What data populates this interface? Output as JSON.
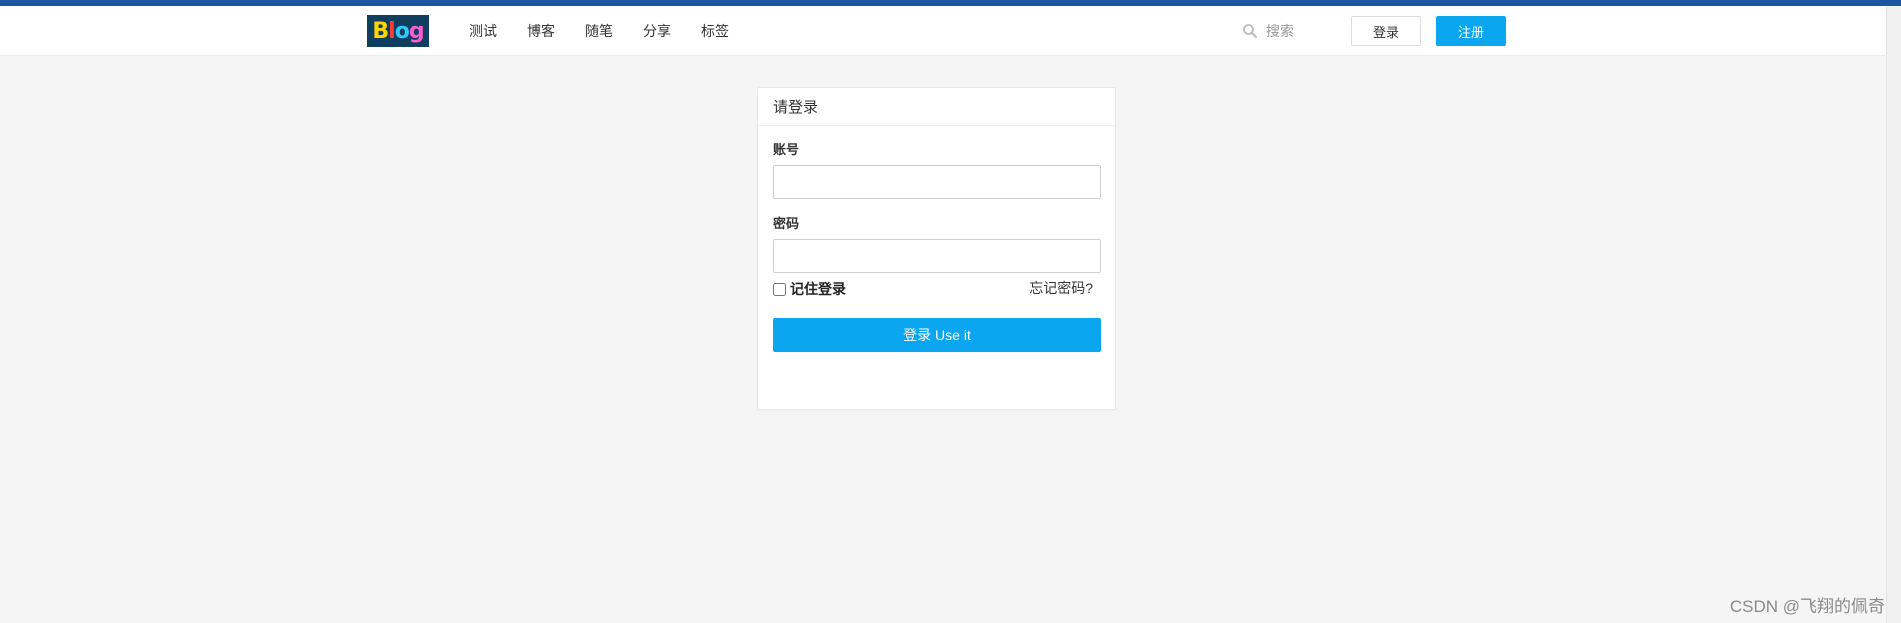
{
  "navbar": {
    "logo_text": "Blog",
    "links": [
      "测试",
      "博客",
      "随笔",
      "分享",
      "标签"
    ],
    "search_placeholder": "搜索",
    "login_label": "登录",
    "register_label": "注册"
  },
  "login_card": {
    "title": "请登录",
    "account_label": "账号",
    "account_value": "",
    "password_label": "密码",
    "password_value": "",
    "remember_label": "记住登录",
    "remember_checked": false,
    "forgot_label": "忘记密码?",
    "submit_label": "登录 Use it"
  },
  "watermark": "CSDN @飞翔的佩奇",
  "colors": {
    "top_strip": "#1b56a0",
    "primary_button": "#0aa6f0",
    "page_background": "#f5f5f5"
  }
}
